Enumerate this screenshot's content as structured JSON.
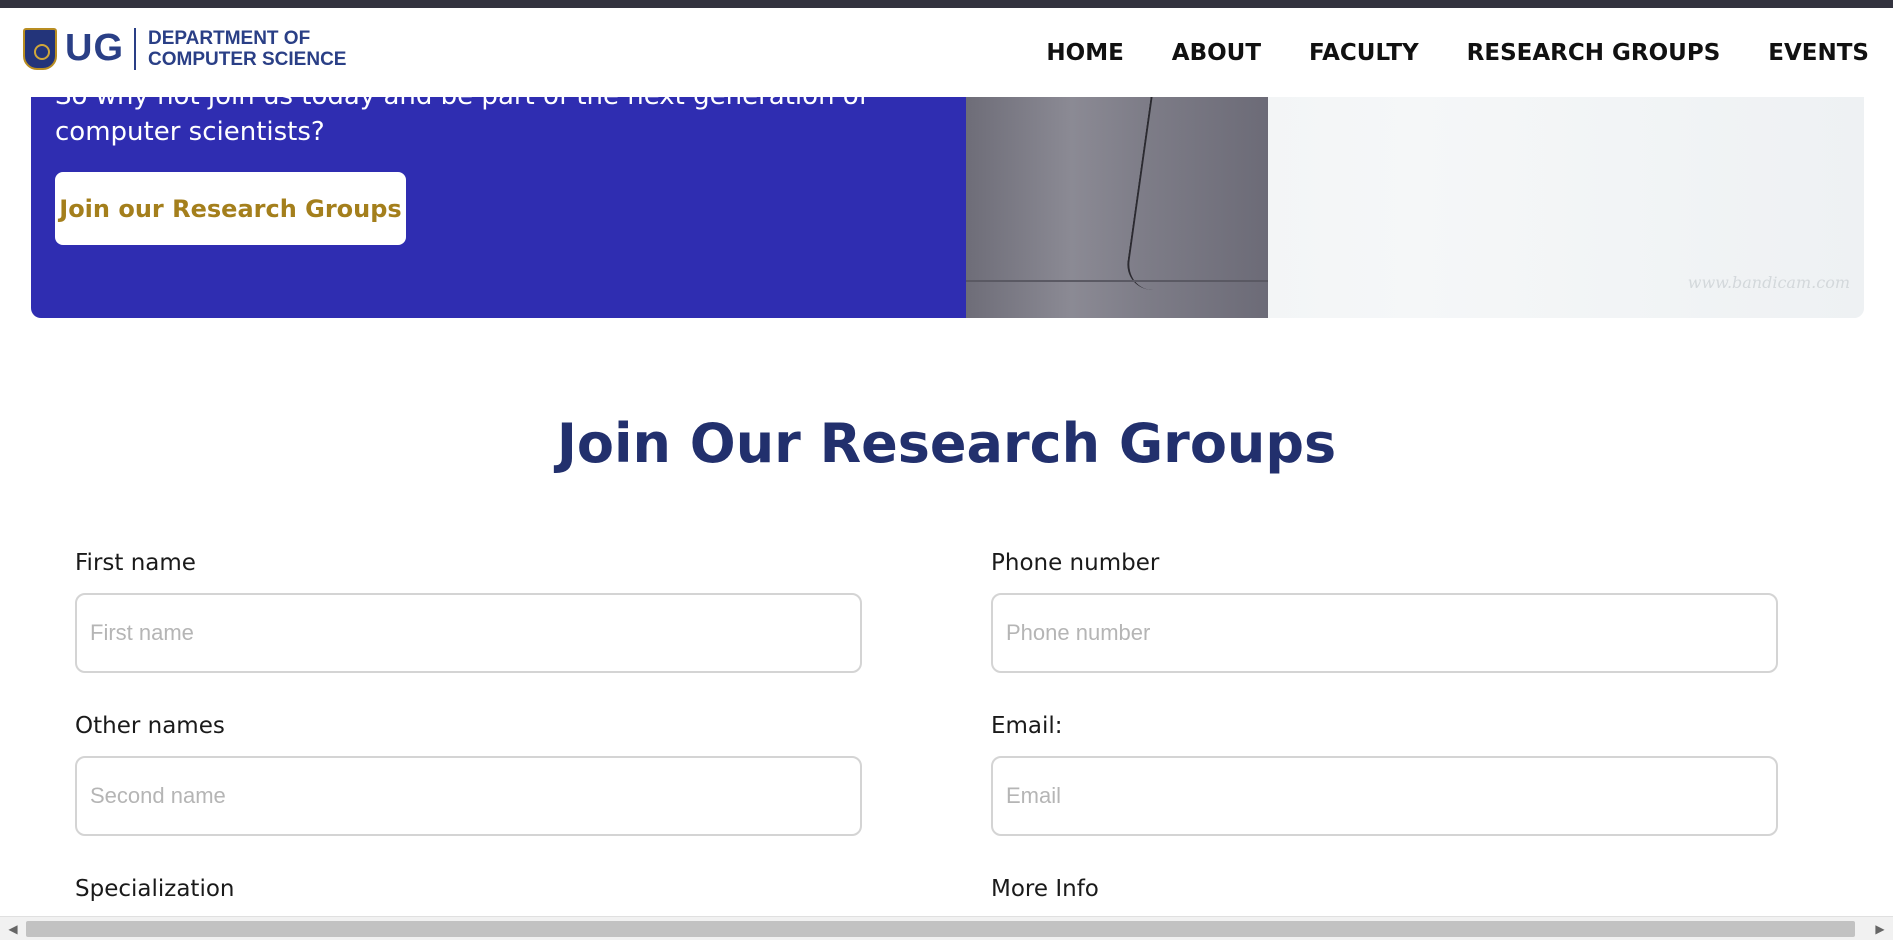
{
  "header": {
    "logo_initials": "UG",
    "dept_line1": "DEPARTMENT OF",
    "dept_line2": "COMPUTER SCIENCE",
    "nav": [
      "HOME",
      "ABOUT",
      "FACULTY",
      "RESEARCH GROUPS",
      "EVENTS"
    ]
  },
  "hero": {
    "text": "So why not join us today and be part of the next generation of computer scientists?",
    "button_label": "Join our Research Groups",
    "watermark": "www.bandicam.com"
  },
  "form": {
    "title": "Join Our Research Groups",
    "first_name_label": "First name",
    "first_name_placeholder": "First name",
    "other_names_label": "Other names",
    "other_names_placeholder": "Second name",
    "specialization_label": "Specialization",
    "phone_label": "Phone number",
    "phone_placeholder": "Phone number",
    "email_label": "Email:",
    "email_placeholder": "Email",
    "more_info_label": "More Info"
  },
  "scrollbar": {
    "left_arrow": "◀",
    "right_arrow": "▶"
  },
  "colors": {
    "hero_bg": "#2f2db1",
    "accent_gold": "#a47f1c",
    "title_navy": "#22306d",
    "brand_blue": "#2a3f86"
  }
}
